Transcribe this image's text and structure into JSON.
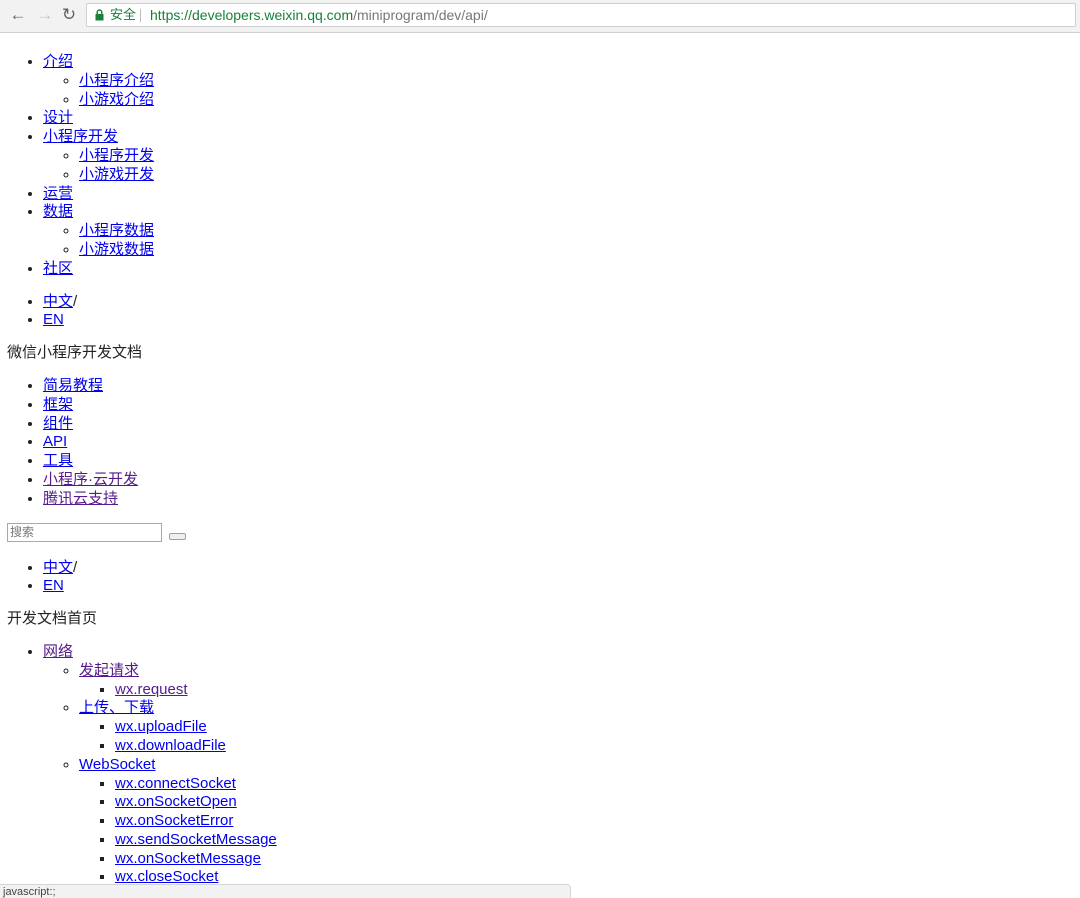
{
  "browser": {
    "back_icon": "arrow-left",
    "forward_icon": "arrow-right",
    "reload_icon": "reload",
    "secure_label": "安全",
    "url_host": "https://developers.weixin.qq.com",
    "url_path": "/miniprogram/dev/api/"
  },
  "top_nav": {
    "intro": "介绍",
    "intro_mini": "小程序介绍",
    "intro_game": "小游戏介绍",
    "design": "设计",
    "dev": "小程序开发",
    "dev_mini": "小程序开发",
    "dev_game": "小游戏开发",
    "ops": "运营",
    "data": "数据",
    "data_mini": "小程序数据",
    "data_game": "小游戏数据",
    "community": "社区"
  },
  "lang1": {
    "zh": "中文",
    "separator": "/",
    "en": "EN"
  },
  "doc_title": "微信小程序开发文档",
  "doc_nav": {
    "tutorial": "简易教程",
    "framework": "框架",
    "component": "组件",
    "api": "API",
    "tools": "工具",
    "cloud": "小程序·云开发",
    "tencent_cloud": "腾讯云支持"
  },
  "search": {
    "placeholder": "搜索"
  },
  "lang2": {
    "zh": "中文",
    "separator": "/",
    "en": "EN"
  },
  "home_title": "开发文档首页",
  "api_nav": {
    "network": "网络",
    "request_group": "发起请求",
    "request": "wx.request",
    "upload_group": "上传、下载",
    "upload_file": "wx.uploadFile",
    "download_file": "wx.downloadFile",
    "websocket_group": "WebSocket",
    "connect_socket": "wx.connectSocket",
    "on_socket_open": "wx.onSocketOpen",
    "on_socket_error": "wx.onSocketError",
    "send_socket_message": "wx.sendSocketMessage",
    "on_socket_message": "wx.onSocketMessage",
    "close_socket": "wx.closeSocket"
  },
  "status_bar": {
    "text": "javascript:;"
  }
}
